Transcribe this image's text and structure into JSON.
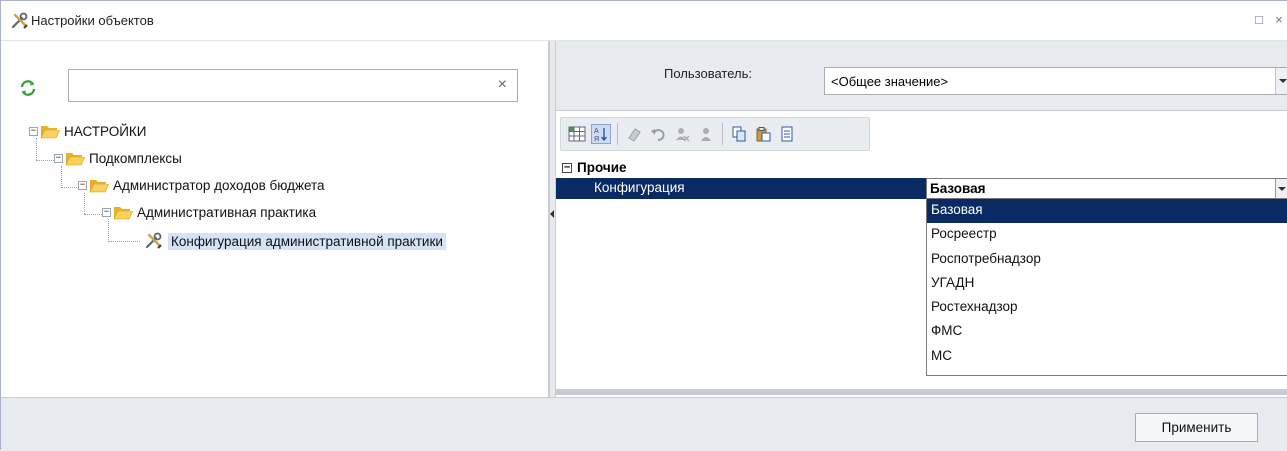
{
  "window": {
    "title": "Настройки объектов",
    "icons": {
      "title": "tools-icon",
      "restore": "restore-icon",
      "close": "close-icon"
    },
    "restore_glyph": "□",
    "close_glyph": "×"
  },
  "left": {
    "search": {
      "value": "",
      "placeholder": "",
      "clear_glyph": "×"
    },
    "tree": {
      "root": {
        "label": "НАСТРОЙКИ",
        "expander": "−"
      },
      "level1": {
        "label": "Подкомплексы",
        "expander": "−"
      },
      "level2": {
        "label": "Администратор доходов бюджета",
        "expander": "−"
      },
      "level3": {
        "label": "Административная практика",
        "expander": "−"
      },
      "level4": {
        "label": "Конфигурация административной практики",
        "selected": true
      }
    }
  },
  "right": {
    "user_label": "Пользователь:",
    "user_value": "<Общее значение>",
    "toolbar": [
      "categorized-icon",
      "alphabetical-icon",
      "eraser-icon",
      "undo-icon",
      "remove-user-icon",
      "user-icon",
      "copy-icon",
      "paste-icon",
      "properties-icon"
    ],
    "category": {
      "label": "Прочие",
      "expander": "−"
    },
    "property": {
      "name": "Конфигурация",
      "value": "Базовая"
    },
    "dropdown_options": [
      "Базовая",
      "Росреестр",
      "Роспотребнадзор",
      "УГАДН",
      "Ростехнадзор",
      "ФМС",
      "МС"
    ],
    "dropdown_selected": "Базовая"
  },
  "footer": {
    "apply_label": "Применить"
  },
  "colors": {
    "selection": "#0a2a63",
    "tree_selection": "#d5e3f7",
    "panel_bg": "#e7eaef",
    "folder": "#f5c53e"
  }
}
